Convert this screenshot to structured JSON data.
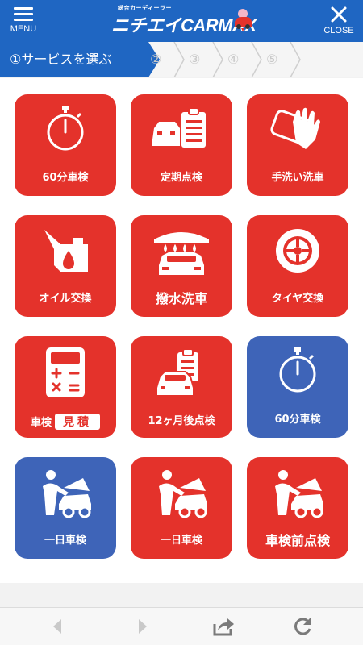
{
  "header": {
    "menu_label": "MENU",
    "close_label": "CLOSE",
    "logo_sub": "総合カーディーラー",
    "logo_main": "ニチエイCARMAX"
  },
  "steps": [
    {
      "label": "①サービスを選ぶ",
      "active": true
    },
    {
      "label": "②",
      "active": false
    },
    {
      "label": "③",
      "active": false
    },
    {
      "label": "④",
      "active": false
    },
    {
      "label": "⑤",
      "active": false
    }
  ],
  "services": [
    {
      "label": "60分車検",
      "icon": "stopwatch-icon",
      "color": "#e4322b"
    },
    {
      "label": "定期点検",
      "icon": "car-checklist-icon",
      "color": "#e4322b"
    },
    {
      "label": "手洗い洗車",
      "icon": "glove-sponge-icon",
      "color": "#e4322b"
    },
    {
      "label": "オイル交換",
      "icon": "oil-can-icon",
      "color": "#e4322b"
    },
    {
      "label": "撥水洗車",
      "icon": "car-wash-icon",
      "color": "#e4322b"
    },
    {
      "label": "タイヤ交換",
      "icon": "tire-icon",
      "color": "#e4322b"
    },
    {
      "label": "車検",
      "label_box": "見積",
      "icon": "calculator-icon",
      "color": "#e4322b"
    },
    {
      "label": "12ヶ月後点検",
      "icon": "car-checklist-icon",
      "color": "#e4322b"
    },
    {
      "label": "60分車検",
      "icon": "stopwatch-icon",
      "color": "#3e64b8"
    },
    {
      "label": "一日車検",
      "icon": "mechanic-icon",
      "color": "#3e64b8"
    },
    {
      "label": "一日車検",
      "icon": "mechanic-icon",
      "color": "#e4322b"
    },
    {
      "label": "車検前点検",
      "icon": "mechanic-icon",
      "color": "#e4322b"
    }
  ],
  "toolbar": {
    "back_icon": "back-arrow-icon",
    "forward_icon": "forward-arrow-icon",
    "share_icon": "share-icon",
    "reload_icon": "reload-icon"
  }
}
